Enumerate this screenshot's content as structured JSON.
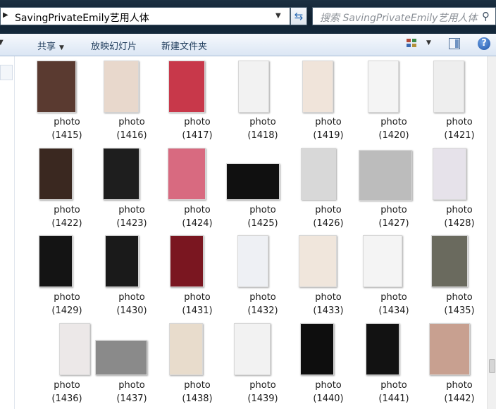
{
  "address": {
    "path": "SavingPrivateEmily艺用人体"
  },
  "search": {
    "placeholder": "搜索 SavingPrivateEmily艺用人体"
  },
  "toolbar": {
    "share": "共享",
    "slideshow": "放映幻灯片",
    "new_folder": "新建文件夹",
    "help": "?"
  },
  "icons": {
    "refresh": "refresh-icon",
    "search": "magnifier-icon",
    "views": "views-icon",
    "preview": "preview-pane-icon",
    "help": "help-icon"
  },
  "items": [
    {
      "name": "photo",
      "num": "(1415)",
      "bg": "#5a3a30"
    },
    {
      "name": "photo",
      "num": "(1416)",
      "bg": "#e8d8cc"
    },
    {
      "name": "photo",
      "num": "(1417)",
      "bg": "#c8384a"
    },
    {
      "name": "photo",
      "num": "(1418)",
      "bg": "#f2f2f2"
    },
    {
      "name": "photo",
      "num": "(1419)",
      "bg": "#f0e4da"
    },
    {
      "name": "photo",
      "num": "(1420)",
      "bg": "#f4f4f4"
    },
    {
      "name": "photo",
      "num": "(1421)",
      "bg": "#eeeeee"
    },
    {
      "name": "photo",
      "num": "(1422)",
      "bg": "#3a2820"
    },
    {
      "name": "photo",
      "num": "(1423)",
      "bg": "#1e1e1e"
    },
    {
      "name": "photo",
      "num": "(1424)",
      "bg": "#d86a80"
    },
    {
      "name": "photo",
      "num": "(1425)",
      "bg": "#101010"
    },
    {
      "name": "photo",
      "num": "(1426)",
      "bg": "#d8d8d8"
    },
    {
      "name": "photo",
      "num": "(1427)",
      "bg": "#bcbcbc"
    },
    {
      "name": "photo",
      "num": "(1428)",
      "bg": "#e6e2ea"
    },
    {
      "name": "photo",
      "num": "(1429)",
      "bg": "#141414"
    },
    {
      "name": "photo",
      "num": "(1430)",
      "bg": "#1a1a1a"
    },
    {
      "name": "photo",
      "num": "(1431)",
      "bg": "#7a1620"
    },
    {
      "name": "photo",
      "num": "(1432)",
      "bg": "#eef0f4"
    },
    {
      "name": "photo",
      "num": "(1433)",
      "bg": "#f0e6dc"
    },
    {
      "name": "photo",
      "num": "(1434)",
      "bg": "#f4f4f4"
    },
    {
      "name": "photo",
      "num": "(1435)",
      "bg": "#6a6a5e"
    },
    {
      "name": "photo",
      "num": "(1436)",
      "bg": "#ece8e8"
    },
    {
      "name": "photo",
      "num": "(1437)",
      "bg": "#8a8a8a"
    },
    {
      "name": "photo",
      "num": "(1438)",
      "bg": "#e8dccc"
    },
    {
      "name": "photo",
      "num": "(1439)",
      "bg": "#f2f2f2"
    },
    {
      "name": "photo",
      "num": "(1440)",
      "bg": "#0e0e0e"
    },
    {
      "name": "photo",
      "num": "(1441)",
      "bg": "#121212"
    },
    {
      "name": "photo",
      "num": "(1442)",
      "bg": "#c8a090"
    }
  ]
}
